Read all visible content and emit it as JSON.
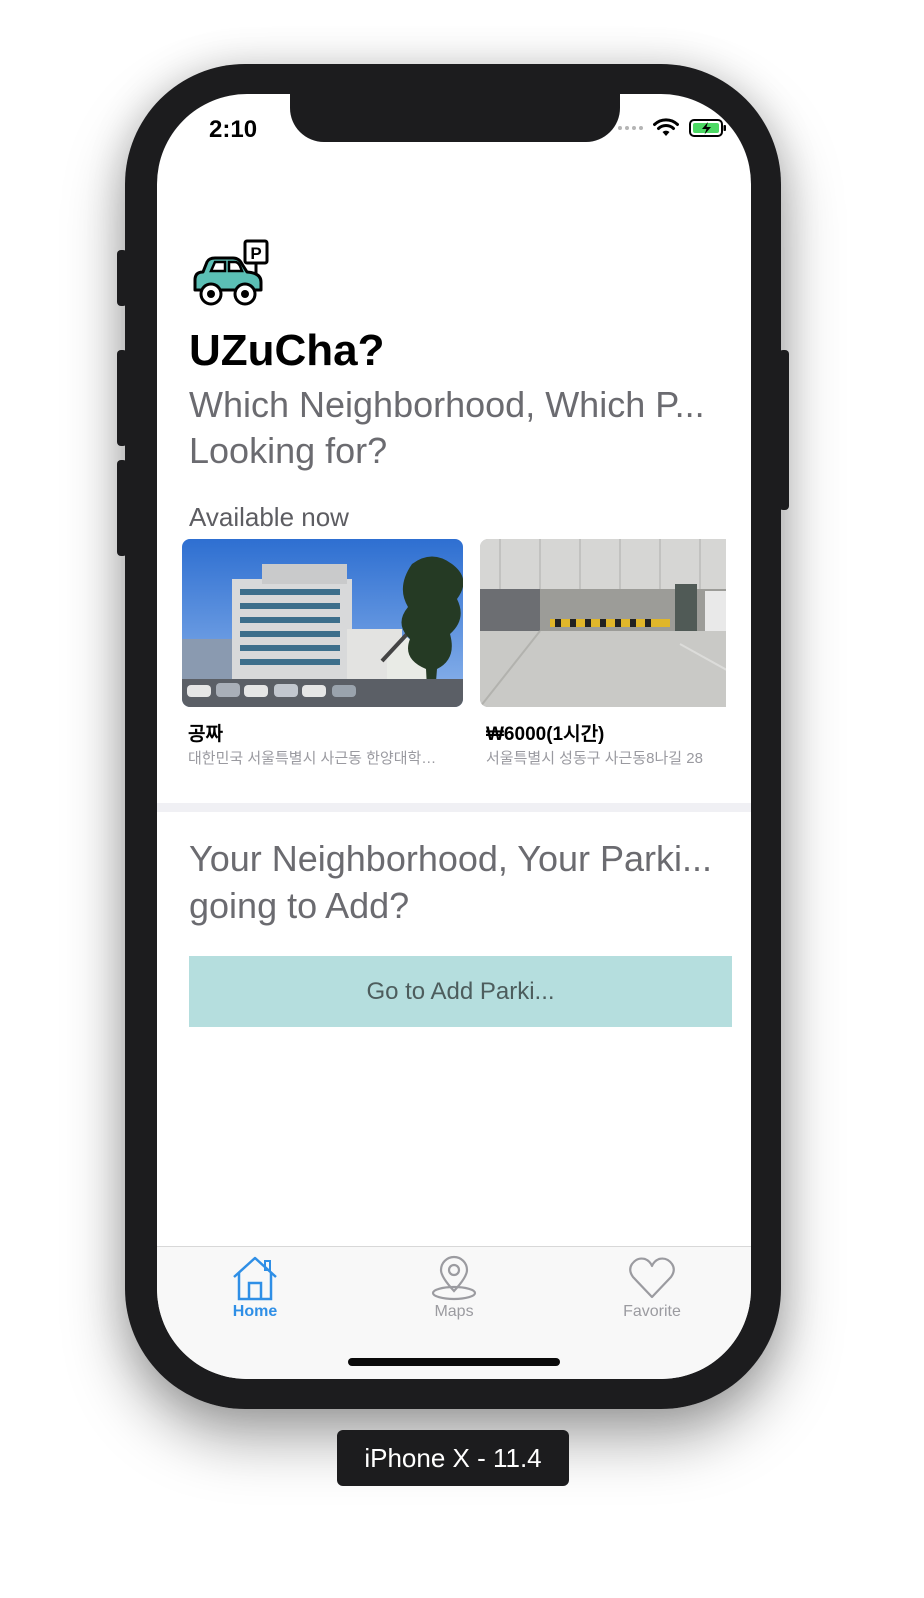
{
  "status_bar": {
    "time": "2:10"
  },
  "app": {
    "title": "UZuCha?",
    "headline_line1": "Which Neighborhood, Which P...",
    "headline_line2": "Looking for?",
    "available_label": "Available now"
  },
  "cards": [
    {
      "price": "공짜",
      "address": "대한민국 서울특별시 사근동 한양대학…"
    },
    {
      "price": "₩6000(1시간)",
      "address": "서울특별시 성동구 사근동8나길 28"
    }
  ],
  "add_section": {
    "line1": "Your Neighborhood, Your Parki...",
    "line2": "going to Add?",
    "button_label": "Go to Add Parki..."
  },
  "tabs": [
    {
      "label": "Home",
      "icon": "home-icon",
      "active": true
    },
    {
      "label": "Maps",
      "icon": "map-pin-icon",
      "active": false
    },
    {
      "label": "Favorite",
      "icon": "heart-icon",
      "active": false
    }
  ],
  "device_label": "iPhone X - 11.4",
  "colors": {
    "accent": "#2f8fe6",
    "tab_inactive": "#9b9ba0",
    "add_button_bg": "#b5dede",
    "logo_car": "#5bbfb5"
  }
}
